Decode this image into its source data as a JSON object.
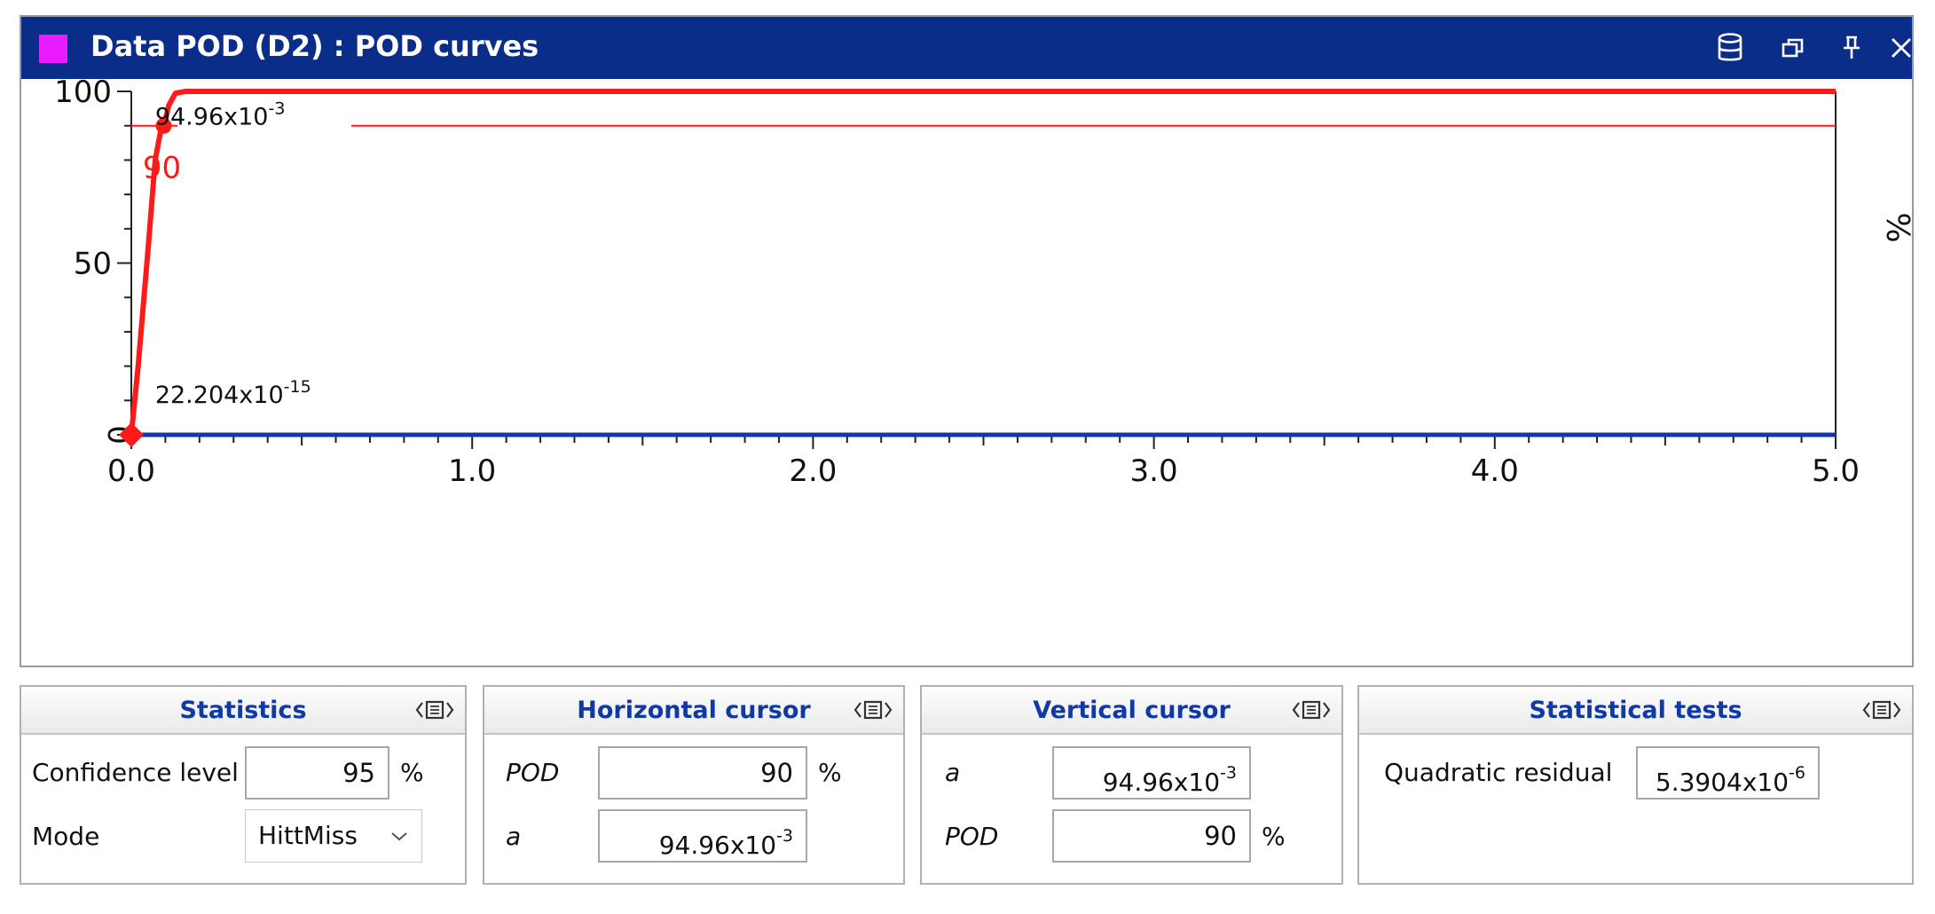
{
  "window": {
    "title": "Data POD (D2) : POD curves",
    "swatch_color": "#e81cff",
    "titlebar_color": "#0a2d8a",
    "icons": [
      "database-icon",
      "restore-icon",
      "pin-icon",
      "close-icon"
    ]
  },
  "chart_data": {
    "type": "line",
    "ylabel": "%",
    "xlim": [
      0.0,
      5.0
    ],
    "ylim": [
      0,
      100
    ],
    "x_tick_labels": [
      "0.0",
      "1.0",
      "2.0",
      "3.0",
      "4.0",
      "5.0"
    ],
    "y_tick_labels": [
      "0",
      "50",
      "100"
    ],
    "grid": false,
    "series": [
      {
        "color": "#ff1a1a",
        "points": [
          [
            0.0,
            0
          ],
          [
            0.02,
            20
          ],
          [
            0.05,
            55
          ],
          [
            0.07,
            80
          ],
          [
            0.085,
            88
          ],
          [
            0.095,
            90
          ],
          [
            0.11,
            96
          ],
          [
            0.13,
            99.5
          ],
          [
            0.16,
            100
          ],
          [
            5.0,
            100
          ]
        ]
      },
      {
        "color": "#1536a8",
        "points": [
          [
            0.0,
            0
          ],
          [
            5.0,
            0
          ]
        ]
      }
    ],
    "horizontal_cursor": {
      "y": 90,
      "color": "#ff1a1a"
    },
    "markers": [
      {
        "x": 0.095,
        "y": 90,
        "shape": "circle",
        "color": "#ff1a1a"
      },
      {
        "x": 0.0,
        "y": 0,
        "shape": "diamond",
        "color": "#ff1a1a"
      }
    ],
    "annotations": [
      {
        "mantissa": "94.96x10",
        "exponent": "-3",
        "x": 0.2,
        "y": 90
      },
      {
        "mantissa": "22.204x10",
        "exponent": "-15",
        "x": 0.2,
        "y": 0
      }
    ],
    "cursor_label": {
      "text": "90",
      "x": 0.095,
      "y": 90,
      "color": "#ff1a1a"
    }
  },
  "panels": {
    "statistics": {
      "title": "Statistics",
      "confidence_label": "Confidence level",
      "confidence_value": "95",
      "confidence_unit": "%",
      "mode_label": "Mode",
      "mode_value": "HittMiss"
    },
    "horizontal_cursor": {
      "title": "Horizontal cursor",
      "pod_label": "POD",
      "pod_value": "90",
      "pod_unit": "%",
      "a_label": "a",
      "a_mantissa": "94.96x10",
      "a_exponent": "-3"
    },
    "vertical_cursor": {
      "title": "Vertical cursor",
      "a_label": "a",
      "a_mantissa": "94.96x10",
      "a_exponent": "-3",
      "pod_label": "POD",
      "pod_value": "90",
      "pod_unit": "%"
    },
    "statistical_tests": {
      "title": "Statistical tests",
      "residual_label": "Quadratic residual",
      "residual_mantissa": "5.3904x10",
      "residual_exponent": "-6"
    }
  }
}
